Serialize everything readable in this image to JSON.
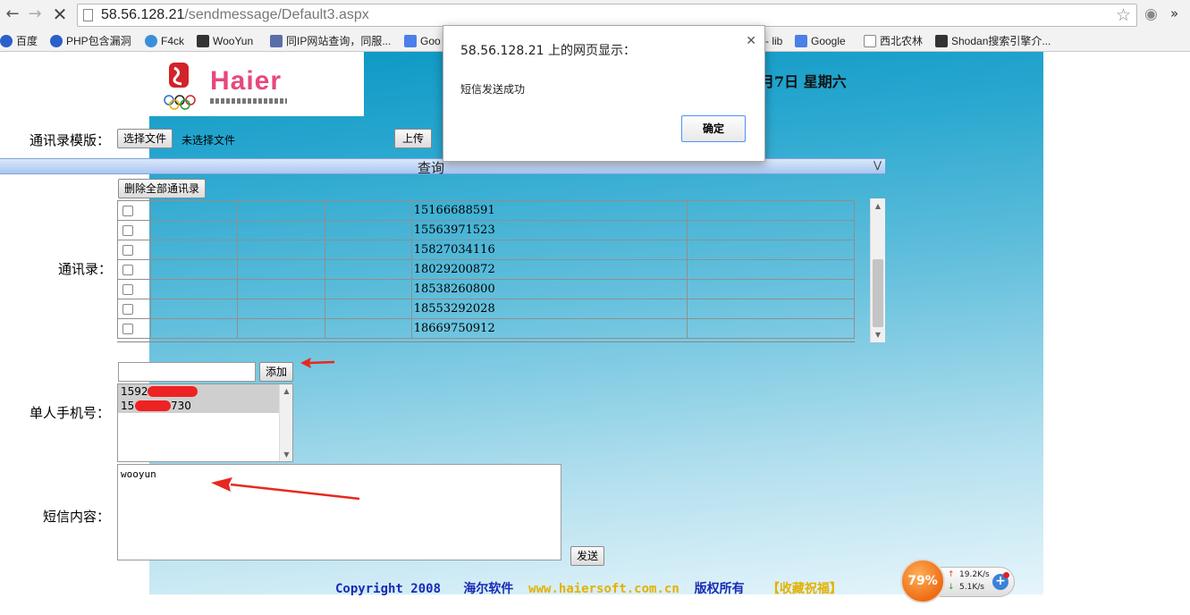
{
  "browser": {
    "url_host": "58.56.128.21",
    "url_path": "/sendmessage/Default3.aspx",
    "bookmarks": [
      "百度",
      "PHP包含漏洞",
      "F4ck",
      "WooYun",
      "同IP网站查询，同服...",
      "Goo",
      "- lib",
      "Google",
      "西北农林",
      "Shodan搜索引擎介..."
    ]
  },
  "header": {
    "logo_text": "Haier",
    "date_text": "月7日  星期六"
  },
  "upload": {
    "label": "通讯录模版：",
    "choose_label": "选择文件",
    "no_file_text": "未选择文件",
    "upload_label": "上传"
  },
  "query": {
    "label": "查询"
  },
  "contacts": {
    "label": "通讯录：",
    "delete_all_label": "删除全部通讯录",
    "rows": [
      {
        "phone": "15166688591"
      },
      {
        "phone": "15563971523"
      },
      {
        "phone": "15827034116"
      },
      {
        "phone": "18029200872"
      },
      {
        "phone": "18538260800"
      },
      {
        "phone": "18553292028"
      },
      {
        "phone": "18669750912"
      }
    ]
  },
  "single": {
    "label": "单人手机号：",
    "input_value": "",
    "add_label": "添加",
    "numbers": [
      "1592",
      "15",
      "730"
    ]
  },
  "sms": {
    "label": "短信内容：",
    "content": "wooyun",
    "send_label": "发送"
  },
  "footer": {
    "copyright": "Copyright 2008",
    "company": "海尔软件",
    "site": "www.haiersoft.com.cn",
    "rights": "版权所有",
    "favorite": "【收藏祝福】"
  },
  "dialog": {
    "title": "58.56.128.21 上的网页显示：",
    "message": "短信发送成功",
    "ok_label": "确定"
  },
  "speed_widget": {
    "percent": "79%",
    "up_speed": "19.2K/s",
    "down_speed": "5.1K/s"
  }
}
